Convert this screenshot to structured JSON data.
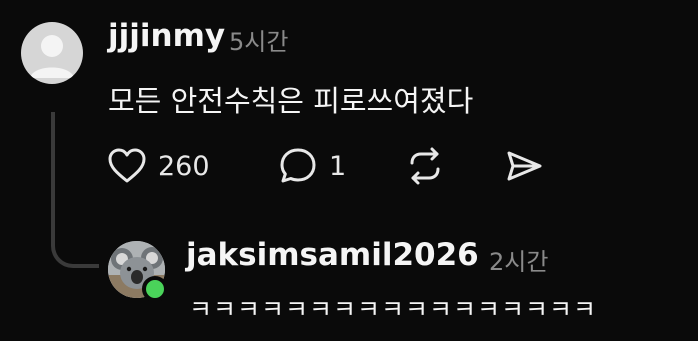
{
  "comment": {
    "username": "jjjinmy",
    "time": "5시간",
    "text": "모든 안전수칙은 피로쓰여졌다",
    "avatar_icon": "default-avatar-icon",
    "actions": {
      "like_count": "260",
      "reply_count": "1",
      "like_icon": "heart-icon",
      "reply_icon": "speech-bubble-icon",
      "repost_icon": "repost-icon",
      "share_icon": "send-icon"
    }
  },
  "reply": {
    "username": "jaksimsamil2026",
    "time": "2시간",
    "text": "ㅋㅋㅋㅋㅋㅋㅋㅋㅋㅋㅋㅋㅋㅋㅋㅋㅋ",
    "avatar_icon": "koala-avatar-icon",
    "status_color": "#4ad35a"
  },
  "colors": {
    "background": "#0a0a0a",
    "text": "#f5f5f5",
    "muted": "#8a8a8a",
    "thread_line": "#3a3a3a"
  }
}
